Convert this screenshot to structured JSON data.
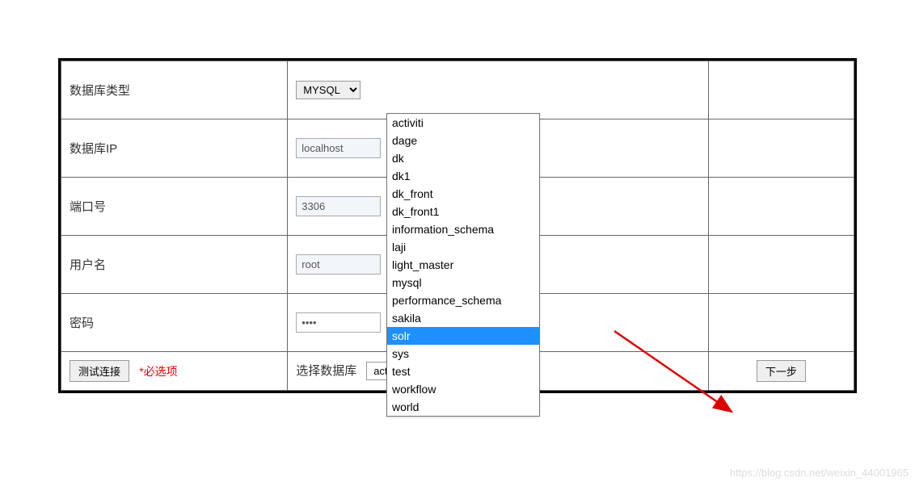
{
  "form": {
    "db_type": {
      "label": "数据库类型",
      "value": "MYSQL"
    },
    "db_ip": {
      "label": "数据库IP",
      "value": "localhost"
    },
    "port": {
      "label": "端口号",
      "value": "3306"
    },
    "username": {
      "label": "用户名",
      "value": "root"
    },
    "password": {
      "label": "密码",
      "value": "••••"
    }
  },
  "footer": {
    "test_button": "测试连接",
    "required_hint": "*必选项",
    "select_db_label": "选择数据库",
    "selected_db": "activiti",
    "next_button": "下一步"
  },
  "dropdown": {
    "options": [
      "activiti",
      "dage",
      "dk",
      "dk1",
      "dk_front",
      "dk_front1",
      "information_schema",
      "laji",
      "light_master",
      "mysql",
      "performance_schema",
      "sakila",
      "solr",
      "sys",
      "test",
      "workflow",
      "world"
    ],
    "highlighted": "solr"
  },
  "watermark": "https://blog.csdn.net/weixin_44001965"
}
